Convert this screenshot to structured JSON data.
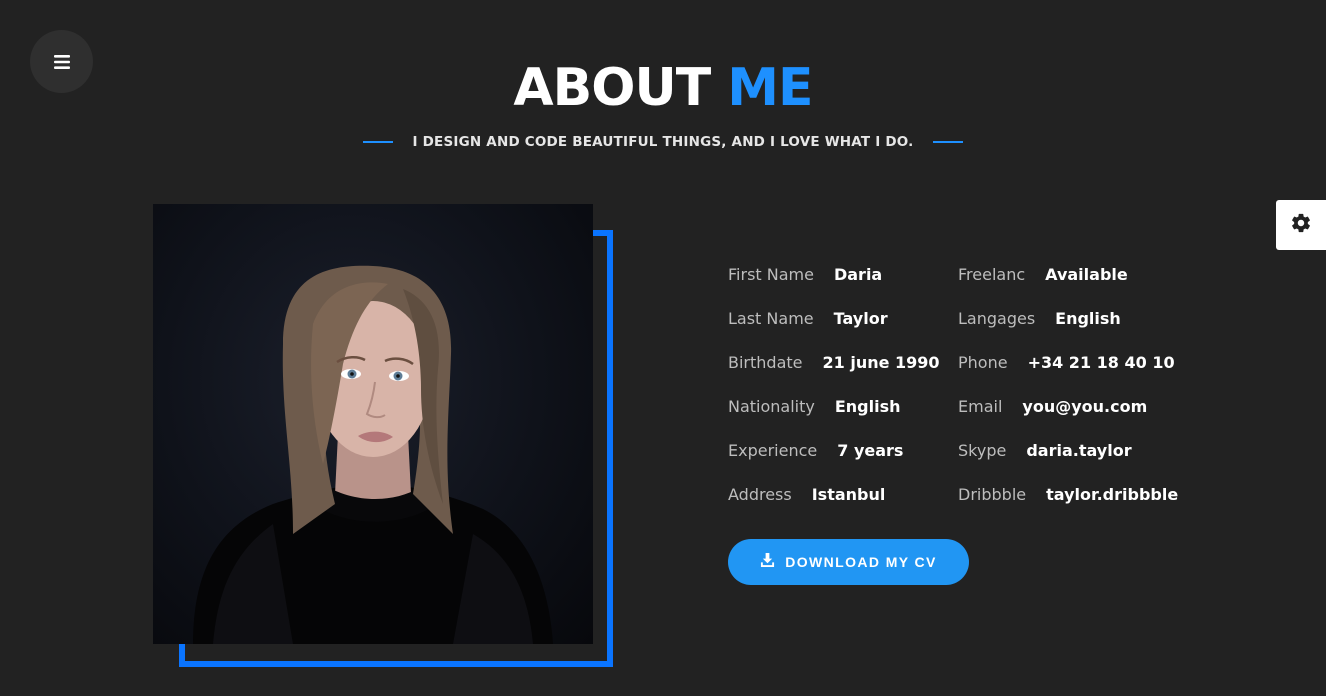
{
  "menu": {
    "icon": "hamburger-menu-icon"
  },
  "settings": {
    "icon": "gear-icon"
  },
  "header": {
    "title_part1": "ABOUT",
    "title_part2": "ME",
    "subtitle": "I DESIGN AND CODE BEAUTIFUL THINGS, AND I LOVE WHAT I DO."
  },
  "colors": {
    "background": "#222222",
    "accent": "#1e90ff",
    "button": "#2196f3",
    "frame": "#0a74ff"
  },
  "info": {
    "left": [
      {
        "label": "First Name",
        "value": "Daria"
      },
      {
        "label": "Last Name",
        "value": "Taylor"
      },
      {
        "label": "Birthdate",
        "value": "21 june 1990"
      },
      {
        "label": "Nationality",
        "value": "English"
      },
      {
        "label": "Experience",
        "value": "7 years"
      },
      {
        "label": "Address",
        "value": "Istanbul"
      }
    ],
    "right": [
      {
        "label": "Freelanc",
        "value": "Available"
      },
      {
        "label": "Langages",
        "value": "English"
      },
      {
        "label": "Phone",
        "value": "+34 21 18 40 10"
      },
      {
        "label": "Email",
        "value": "you@you.com"
      },
      {
        "label": "Skype",
        "value": "daria.taylor"
      },
      {
        "label": "Dribbble",
        "value": "taylor.dribbble"
      }
    ]
  },
  "download": {
    "label": "DOWNLOAD MY CV",
    "icon": "download-icon"
  }
}
